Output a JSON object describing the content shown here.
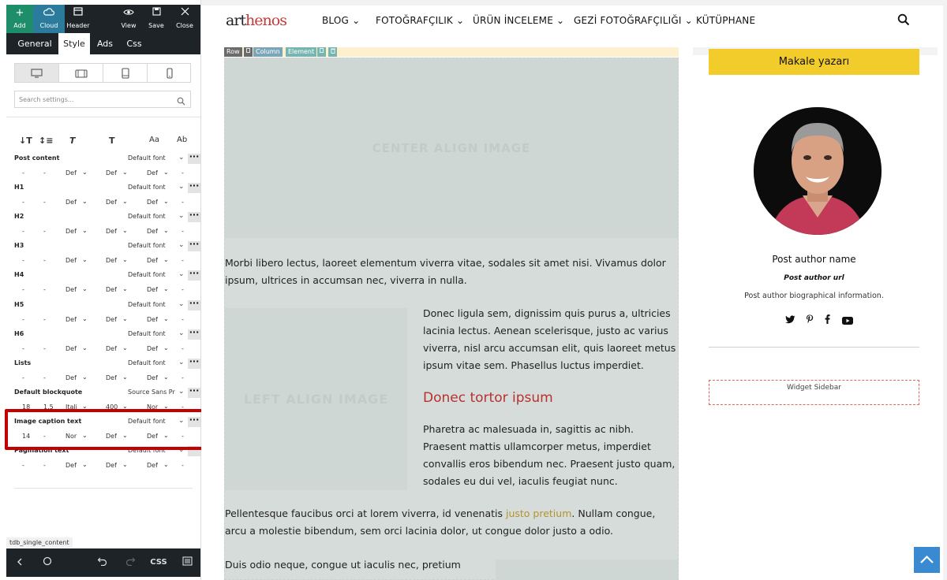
{
  "toolbar": {
    "add": "Add",
    "cloud": "Cloud",
    "header": "Header",
    "view": "View",
    "save": "Save",
    "close": "Close"
  },
  "tabs": {
    "general": "General",
    "style": "Style",
    "ads": "Ads",
    "css": "Css"
  },
  "search": {
    "placeholder": "Search settings..."
  },
  "typography_rows": [
    {
      "name": "Post content",
      "font": "Default font",
      "vals": [
        "-",
        "-",
        "Def",
        "Def",
        "Def",
        "-"
      ]
    },
    {
      "name": "H1",
      "font": "Default font",
      "vals": [
        "-",
        "-",
        "Def",
        "Def",
        "Def",
        "-"
      ]
    },
    {
      "name": "H2",
      "font": "Default font",
      "vals": [
        "-",
        "-",
        "Def",
        "Def",
        "Def",
        "-"
      ]
    },
    {
      "name": "H3",
      "font": "Default font",
      "vals": [
        "-",
        "-",
        "Def",
        "Def",
        "Def",
        "-"
      ]
    },
    {
      "name": "H4",
      "font": "Default font",
      "vals": [
        "-",
        "-",
        "Def",
        "Def",
        "Def",
        "-"
      ]
    },
    {
      "name": "H5",
      "font": "Default font",
      "vals": [
        "-",
        "-",
        "Def",
        "Def",
        "Def",
        "-"
      ]
    },
    {
      "name": "H6",
      "font": "Default font",
      "vals": [
        "-",
        "-",
        "Def",
        "Def",
        "Def",
        "-"
      ]
    },
    {
      "name": "Lists",
      "font": "Default font",
      "vals": [
        "-",
        "-",
        "Def",
        "Def",
        "Def",
        "-"
      ]
    },
    {
      "name": "Default blockquote",
      "font": "Source Sans Pr",
      "vals": [
        "18",
        "1.5",
        "Itali",
        "400",
        "Nor",
        "-"
      ]
    },
    {
      "name": "Image caption text",
      "font": "Default font",
      "vals": [
        "14",
        "-",
        "Nor",
        "Def",
        "Def",
        "-"
      ]
    },
    {
      "name": "Pagination text",
      "font": "Default font",
      "vals": [
        "-",
        "-",
        "Def",
        "Def",
        "Def",
        "-"
      ]
    }
  ],
  "font_icons": [
    "↓T",
    "↕≡",
    "T",
    "T",
    "Aa",
    "A̵b"
  ],
  "breadcrumb": "tdb_single_content",
  "bottom": {
    "css": "CSS"
  },
  "site": {
    "logo_a": "art",
    "logo_b": "henos",
    "menu": [
      "BLOG",
      "FOTOĞRAFÇILIK",
      "ÜRÜN İNCELEME",
      "GEZİ FOTOĞRAFÇILIĞI",
      "KÜTÜPHANE"
    ]
  },
  "builder": {
    "row": "Row",
    "column": "Column",
    "element": "Element"
  },
  "content": {
    "center_image": "CENTER ALIGN IMAGE",
    "p1": "Morbi libero lectus, laoreet elementum viverra vitae, sodales sit amet nisi. Vivamus dolor ipsum, ultrices in accumsan nec, viverra in nulla.",
    "left_image": "LEFT ALIGN IMAGE",
    "p2": "Donec ligula sem, dignissim quis purus a, ultricies lacinia lectus. Aenean scelerisque, justo ac varius viverra, nisl arcu accumsan elit, quis laoreet metus ipsum vitae sem. Phasellus luctus imperdiet.",
    "h3": "Donec tortor ipsum",
    "p3": "Pharetra ac malesuada in, sagittis ac nibh. Praesent mattis ullamcorper metus, imperdiet convallis eros bibendum nec. Praesent justo quam, sodales eu dui vel, iaculis feugiat nunc.",
    "p4_a": "Pellentesque faucibus orci at lorem viverra, id venenatis ",
    "p4_link": "justo pretium",
    "p4_b": ". Nullam congue, arcu a molestie bibendum, sem orci lacinia dolor, ut congue dolor justo a odio.",
    "p5": "Duis odio neque, congue ut iaculis nec, pretium"
  },
  "sidebar": {
    "author_button": "Makale yazarı",
    "author_name": "Post author name",
    "author_url": "Post author url",
    "author_bio": "Post author biographical information.",
    "widget": "Widget Sidebar"
  },
  "colors": {
    "panel_dark": "#1d2327",
    "accent_green": "#1e8e6a",
    "highlight_red": "#c40000",
    "author_yellow": "#f2cc2b",
    "heading_red": "#b8312f",
    "link_gold": "#b5922e",
    "scroll_blue": "#3a8ad1"
  }
}
